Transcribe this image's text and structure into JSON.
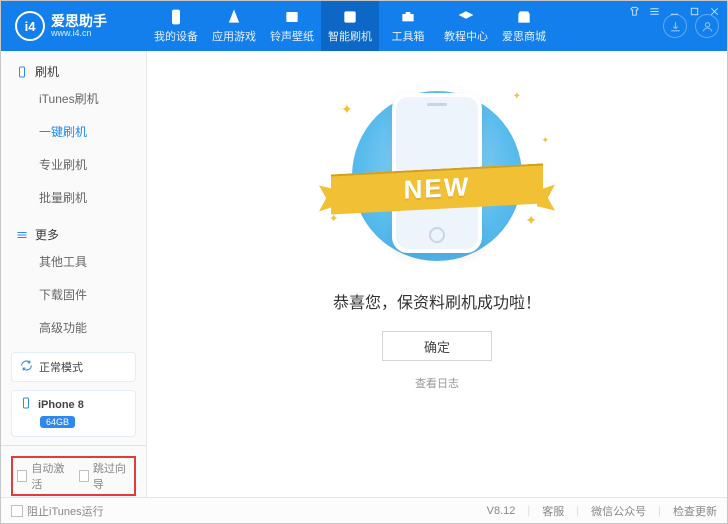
{
  "logo": {
    "badge": "i4",
    "title": "爱思助手",
    "subtitle": "www.i4.cn"
  },
  "nav": {
    "items": [
      {
        "label": "我的设备"
      },
      {
        "label": "应用游戏"
      },
      {
        "label": "铃声壁纸"
      },
      {
        "label": "智能刷机"
      },
      {
        "label": "工具箱"
      },
      {
        "label": "教程中心"
      },
      {
        "label": "爱思商城"
      }
    ]
  },
  "sidebar": {
    "section1": "刷机",
    "items1": [
      "iTunes刷机",
      "一键刷机",
      "专业刷机",
      "批量刷机"
    ],
    "section2": "更多",
    "items2": [
      "其他工具",
      "下载固件",
      "高级功能"
    ],
    "mode": "正常模式",
    "device": "iPhone 8",
    "storage": "64GB",
    "chk1": "自动激活",
    "chk2": "跳过向导"
  },
  "main": {
    "ribbon": "NEW",
    "message": "恭喜您，保资料刷机成功啦！",
    "ok": "确定",
    "log": "查看日志"
  },
  "footer": {
    "block_itunes": "阻止iTunes运行",
    "version": "V8.12",
    "l1": "客服",
    "l2": "微信公众号",
    "l3": "检查更新"
  }
}
